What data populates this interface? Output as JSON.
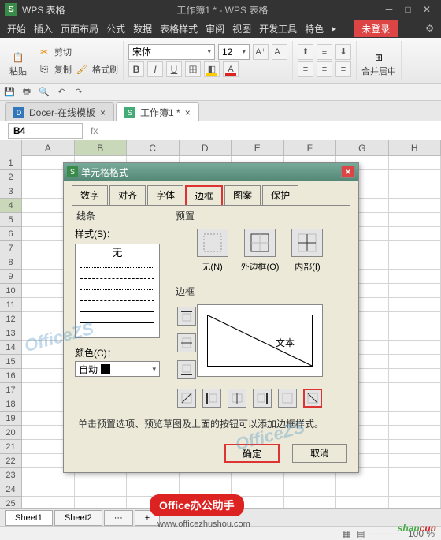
{
  "app": {
    "brand": "WPS 表格",
    "doc_title": "工作簿1 * - WPS 表格"
  },
  "menu": {
    "items": [
      "开始",
      "插入",
      "页面布局",
      "公式",
      "数据",
      "表格样式",
      "审阅",
      "视图",
      "开发工具",
      "特色"
    ],
    "login": "未登录"
  },
  "toolbar": {
    "cut": "剪切",
    "copy": "复制",
    "paste": "粘贴",
    "format_painter": "格式刷",
    "font_name": "宋体",
    "font_size": "12",
    "merge_center": "合并居中"
  },
  "doc_tabs": {
    "docer": "Docer-在线模板",
    "workbook": "工作簿1 *"
  },
  "namebox": "B4",
  "columns": [
    "A",
    "B",
    "C",
    "D",
    "E",
    "F",
    "G",
    "H"
  ],
  "row_count": 26,
  "sheets": {
    "s1": "Sheet1",
    "s2": "Sheet2",
    "s3": "···",
    "add": "+"
  },
  "statusbar": {
    "zoom": "100 %"
  },
  "dialog": {
    "title": "单元格格式",
    "tabs": {
      "number": "数字",
      "align": "对齐",
      "font": "字体",
      "border": "边框",
      "pattern": "图案",
      "protect": "保护"
    },
    "line_group": "线条",
    "style_label": "样式(S)：",
    "style_none": "无",
    "color_label": "颜色(C)：",
    "color_auto": "自动",
    "preset_group": "预置",
    "preset_none": "无(N)",
    "preset_outline": "外边框(O)",
    "preset_inside": "内部(I)",
    "border_group": "边框",
    "preview_text": "文本",
    "hint": "单击预置选项、预览草图及上面的按钮可以添加边框样式。",
    "ok": "确定",
    "cancel": "取消"
  },
  "overlay": {
    "banner": "Office办公助手",
    "url": "www.officezhushou.com",
    "brand1": "shan",
    "brand2": "cun"
  }
}
